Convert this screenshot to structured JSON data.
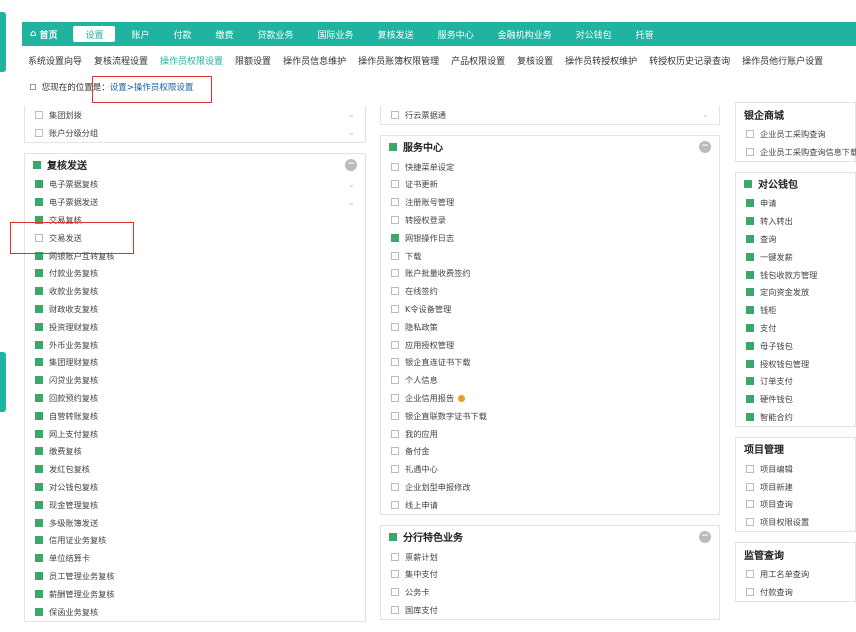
{
  "nav": {
    "home": "首页",
    "items": [
      "设置",
      "账户",
      "付款",
      "缴费",
      "贷款业务",
      "国际业务",
      "复核发送",
      "服务中心",
      "金融机构业务",
      "对公钱包",
      "托管"
    ],
    "active_index": 0
  },
  "subnav": {
    "items": [
      "系统设置向导",
      "复核流程设置",
      "操作员权限设置",
      "限额设置",
      "操作员信息维护",
      "操作员账簿权限管理",
      "产品权限设置",
      "复核设置",
      "操作员转授权维护",
      "转授权历史记录查询",
      "操作员他行账户设置"
    ],
    "active_index": 2
  },
  "breadcrumb": {
    "prefix": "您现在的位置是：",
    "path": "设置>操作员权限设置"
  },
  "left_top": {
    "items": [
      {
        "label": "集团划拨",
        "checked": false
      },
      {
        "label": "账户分级分组",
        "checked": false
      }
    ]
  },
  "left_panel": {
    "title": "复核发送",
    "items": [
      {
        "label": "电子票据复核",
        "checked": true
      },
      {
        "label": "电子票据发送",
        "checked": true
      },
      {
        "label": "交易复核",
        "checked": true
      },
      {
        "label": "交易发送",
        "checked": false
      },
      {
        "label": "网银账户互转复核",
        "checked": true
      },
      {
        "label": "付款业务复核",
        "checked": true
      },
      {
        "label": "收款业务复核",
        "checked": true
      },
      {
        "label": "财政收支复核",
        "checked": true
      },
      {
        "label": "投资理财复核",
        "checked": true
      },
      {
        "label": "外币业务复核",
        "checked": true
      },
      {
        "label": "集团理财复核",
        "checked": true
      },
      {
        "label": "闪贷业务复核",
        "checked": true
      },
      {
        "label": "回款预约复核",
        "checked": true
      },
      {
        "label": "自营转账复核",
        "checked": true
      },
      {
        "label": "网上支付复核",
        "checked": true
      },
      {
        "label": "缴费复核",
        "checked": true
      },
      {
        "label": "发红包复核",
        "checked": true
      },
      {
        "label": "对公钱包复核",
        "checked": true
      },
      {
        "label": "现金管理复核",
        "checked": true
      },
      {
        "label": "多级账簿发送",
        "checked": true
      },
      {
        "label": "信用证业务复核",
        "checked": true
      },
      {
        "label": "单位结算卡",
        "checked": true
      },
      {
        "label": "员工管理业务复核",
        "checked": true
      },
      {
        "label": "薪酬管理业务复核",
        "checked": true
      },
      {
        "label": "保函业务复核",
        "checked": true
      }
    ]
  },
  "mid_top": {
    "items": [
      {
        "label": "行云票据通",
        "checked": false
      }
    ]
  },
  "mid_panel1": {
    "title": "服务中心",
    "items": [
      {
        "label": "快捷菜单设定",
        "checked": false
      },
      {
        "label": "证书更新",
        "checked": false
      },
      {
        "label": "注册账号管理",
        "checked": false
      },
      {
        "label": "转授权登录",
        "checked": false
      },
      {
        "label": "网银操作日志",
        "checked": true
      },
      {
        "label": "下载",
        "checked": false
      },
      {
        "label": "账户批量收费签约",
        "checked": false
      },
      {
        "label": "在线签约",
        "checked": false
      },
      {
        "label": "K令设备管理",
        "checked": false
      },
      {
        "label": "隐私政策",
        "checked": false
      },
      {
        "label": "应用授权管理",
        "checked": false
      },
      {
        "label": "银企直连证书下载",
        "checked": false
      },
      {
        "label": "个人信息",
        "checked": false
      },
      {
        "label": "企业信用报告",
        "checked": false
      },
      {
        "label": "银企直联数字证书下载",
        "checked": false
      },
      {
        "label": "我的应用",
        "checked": false
      },
      {
        "label": "备付金",
        "checked": false
      },
      {
        "label": "礼遇中心",
        "checked": false
      },
      {
        "label": "企业划型申报修改",
        "checked": false
      },
      {
        "label": "线上申请",
        "checked": false
      }
    ]
  },
  "mid_panel2": {
    "title": "分行特色业务",
    "items": [
      {
        "label": "禀薪计划",
        "checked": false
      },
      {
        "label": "集中支付",
        "checked": false
      },
      {
        "label": "公务卡",
        "checked": false
      },
      {
        "label": "国库支付",
        "checked": false
      }
    ]
  },
  "right_panel0": {
    "title": "银企商城",
    "items": [
      {
        "label": "企业员工采购查询",
        "checked": false
      },
      {
        "label": "企业员工采购查询信息下载",
        "checked": false
      }
    ]
  },
  "right_panel1": {
    "title": "对公钱包",
    "items": [
      {
        "label": "申请",
        "checked": true
      },
      {
        "label": "转入转出",
        "checked": true
      },
      {
        "label": "查询",
        "checked": true
      },
      {
        "label": "一键发薪",
        "checked": true
      },
      {
        "label": "钱包收款方管理",
        "checked": true
      },
      {
        "label": "定向资金发放",
        "checked": true
      },
      {
        "label": "钱柜",
        "checked": true
      },
      {
        "label": "支付",
        "checked": true
      },
      {
        "label": "母子钱包",
        "checked": true
      },
      {
        "label": "授权钱包管理",
        "checked": true
      },
      {
        "label": "订单支付",
        "checked": true
      },
      {
        "label": "硬件钱包",
        "checked": true
      },
      {
        "label": "智能合约",
        "checked": true
      }
    ]
  },
  "right_panel2": {
    "title": "项目管理",
    "items": [
      {
        "label": "项目编辑",
        "checked": false
      },
      {
        "label": "项目新建",
        "checked": false
      },
      {
        "label": "项目查询",
        "checked": false
      },
      {
        "label": "项目权限设置",
        "checked": false
      }
    ]
  },
  "right_panel3": {
    "title": "监管查询",
    "items": [
      {
        "label": "用工名单查询",
        "checked": false
      },
      {
        "label": "付款查询",
        "checked": false
      }
    ]
  },
  "colors": {
    "accent": "#1fb3a0",
    "check": "#3aa86a",
    "highlight": "#d33"
  }
}
